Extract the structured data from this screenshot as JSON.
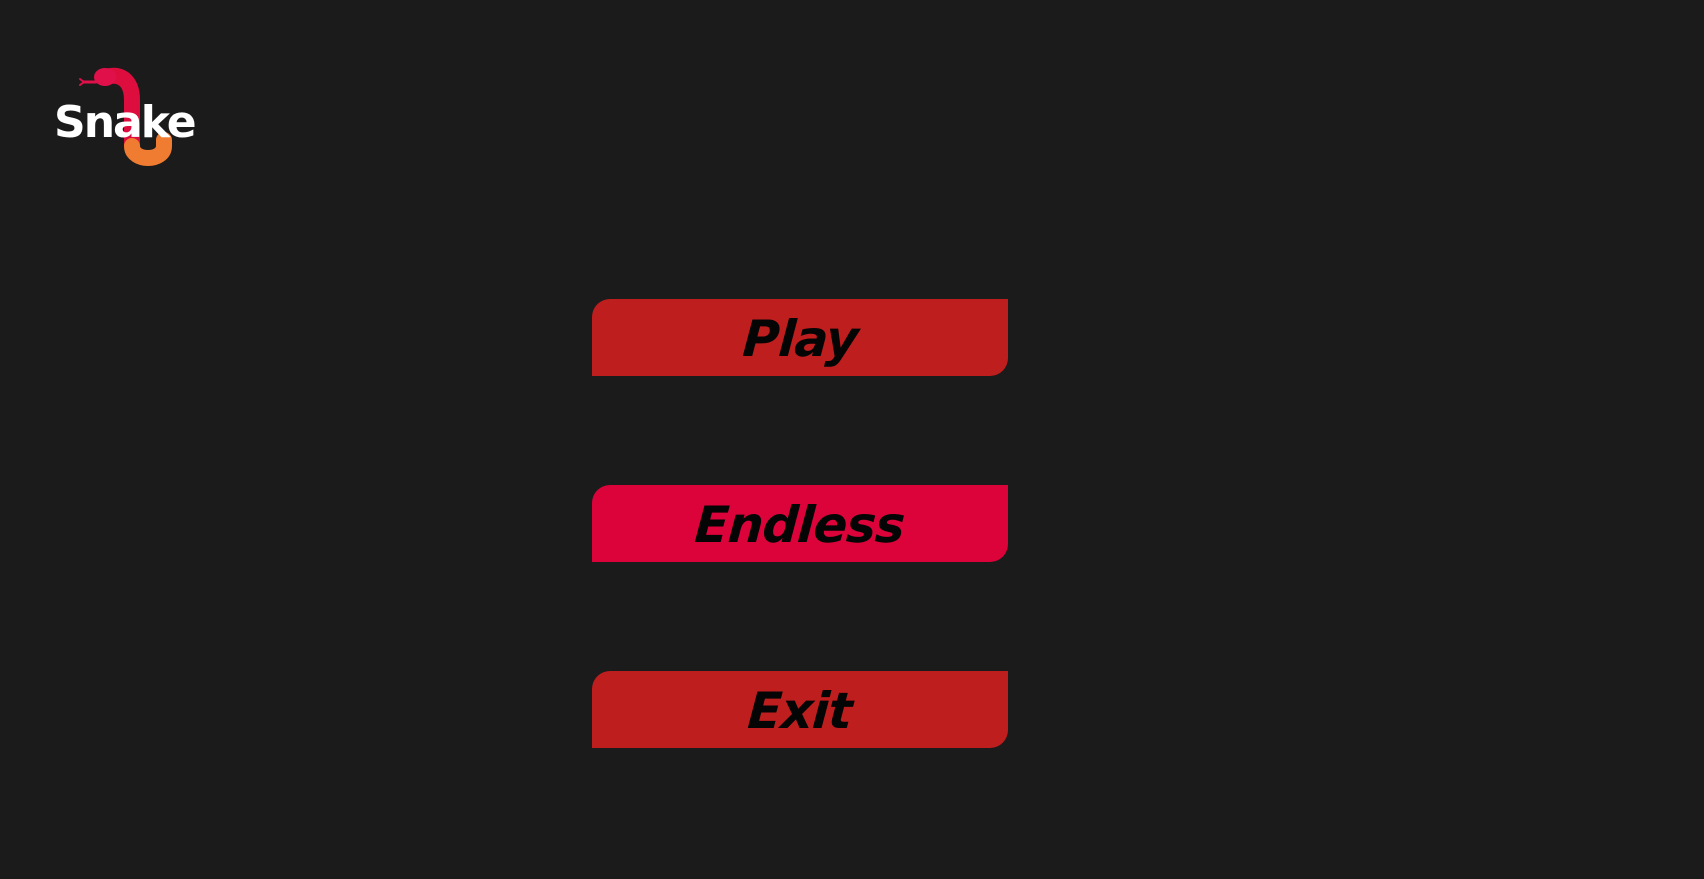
{
  "logo": {
    "text": "Snake",
    "colors": {
      "text": "#ffffff",
      "snake_body": "#dd0e3e",
      "snake_head": "#e0104a",
      "snake_tail": "#f07c32",
      "tongue": "#e0104a"
    }
  },
  "menu": {
    "buttons": [
      {
        "label": "Play",
        "color": "#bf1e1e"
      },
      {
        "label": "Endless",
        "color": "#dc033b"
      },
      {
        "label": "Exit",
        "color": "#bf1e1e"
      }
    ]
  },
  "colors": {
    "background": "#1b1b1b",
    "button_text": "#050505"
  }
}
